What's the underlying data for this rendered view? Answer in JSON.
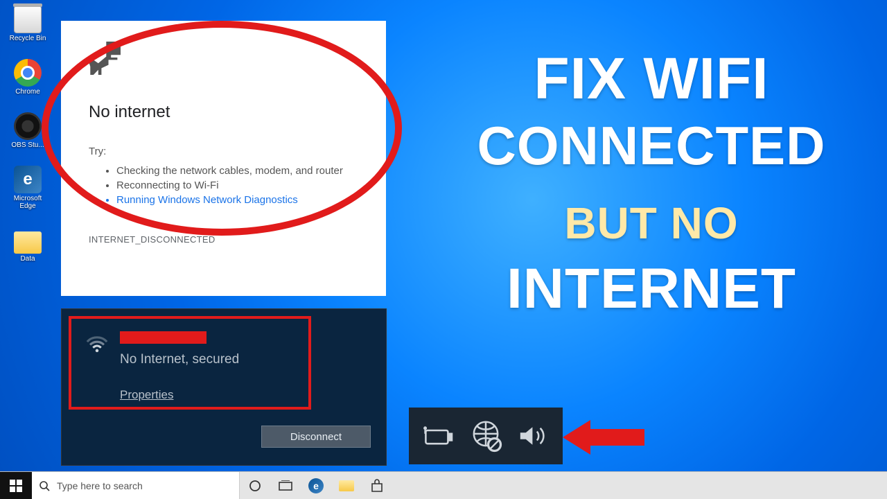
{
  "desktop_icons": {
    "recycle": "Recycle Bin",
    "chrome": "Chrome",
    "obs": "OBS Stu...",
    "edge": "Microsoft Edge",
    "data": "Data"
  },
  "chrome_error": {
    "title": "No internet",
    "try_label": "Try:",
    "suggestions": [
      "Checking the network cables, modem, and router",
      "Reconnecting to Wi-Fi"
    ],
    "diagnostics_link": "Running Windows Network Diagnostics",
    "error_code": "INTERNET_DISCONNECTED"
  },
  "wifi_flyout": {
    "status": "No Internet, secured",
    "properties": "Properties",
    "disconnect": "Disconnect"
  },
  "headline": {
    "l1": "FIX  WIFI",
    "l2": "CONNECTED",
    "l3": "BUT NO",
    "l4": "INTERNET"
  },
  "taskbar": {
    "search_placeholder": "Type here to search"
  }
}
